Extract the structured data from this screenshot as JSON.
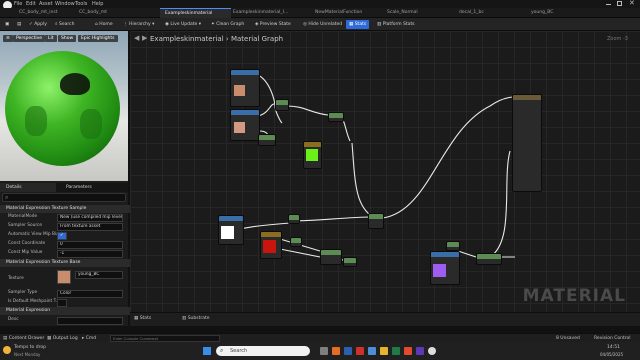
{
  "menu": {
    "items": [
      "File",
      "Edit",
      "Asset",
      "Window",
      "Tools",
      "Help"
    ]
  },
  "tabs": [
    {
      "label": "CC_body_mt_inst"
    },
    {
      "label": "CC_body_mt"
    },
    {
      "label": "Exampleskinmaterial"
    },
    {
      "label": "Exampleskinmaterial_I..."
    },
    {
      "label": "NewMaterialFunction"
    },
    {
      "label": "Scale_Normal"
    },
    {
      "label": "decal_1_bc"
    },
    {
      "label": "young_BC"
    }
  ],
  "toolbar": {
    "save": "Save",
    "browse": "Browse",
    "apply": "Apply",
    "search": "Search",
    "home": "Home",
    "hierarchy": "Hierarchy",
    "live_update": "Live Update",
    "clean_graph": "Clean Graph",
    "preview_state": "Preview State",
    "hide_unrelated": "Hide Unrelated",
    "stats": "Stats",
    "platform_stats": "Platform Stats"
  },
  "viewport": {
    "perspective": "Perspective",
    "lit": "Lit",
    "show": "Show",
    "epic_highlights": "Epic Highlights"
  },
  "panels": {
    "details": "Details",
    "parameters": "Parameters"
  },
  "details": {
    "section1": "Material Expression Texture Sample",
    "rows1": [
      {
        "label": "MaterialMode",
        "value": "New (use compiled mip level)"
      },
      {
        "label": "Sampler Source",
        "value": "From texture asset"
      },
      {
        "label": "Automatic View Mip Bias",
        "value": "✓"
      },
      {
        "label": "Const Coordinate",
        "value": "0"
      },
      {
        "label": "Const Mip Value",
        "value": "-1"
      }
    ],
    "section2": "Material Expression Texture Base",
    "texture_label": "Texture",
    "texture_value": "young_BC",
    "sampler_type_label": "Sampler Type",
    "sampler_type_value": "Color",
    "row_default_mp": "Is Default Meshpaint T...",
    "section3": "Material Expression",
    "desc_label": "Desc"
  },
  "graph": {
    "breadcrumb_root": "Exampleskinmaterial",
    "breadcrumb_sep": "›",
    "breadcrumb_leaf": "Material Graph",
    "zoom": "Zoom -3",
    "watermark": "MATERIAL"
  },
  "graph_bottom": {
    "stats": "Stats",
    "substrate": "Substrate"
  },
  "status": {
    "content_drawer": "Content Drawer",
    "output_log": "Output Log",
    "cmd": "Cmd",
    "console_placeholder": "Enter Console Command",
    "unsaved": "8 Unsaved",
    "revision": "Revision Control"
  },
  "taskbar": {
    "weather_title": "Temps to drop",
    "weather_sub": "Next Monday",
    "search_placeholder": "Search",
    "time": "14:51",
    "date": "04/05/2025"
  },
  "colors": {
    "accent": "#2f6bd8",
    "node_green": "#6af218",
    "node_red": "#c8150d",
    "node_purple": "#9e5cf0",
    "node_white": "#ffffff",
    "sphere": "#3fb524"
  }
}
